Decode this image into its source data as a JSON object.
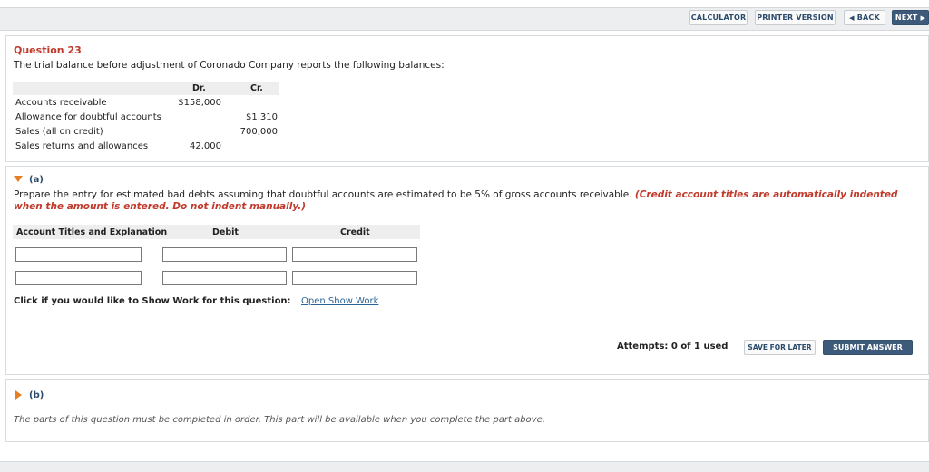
{
  "toolbar": {
    "calculator": "CALCULATOR",
    "printer_version": "PRINTER VERSION",
    "back": "BACK",
    "next": "NEXT"
  },
  "question": {
    "title": "Question 23",
    "text": "The trial balance before adjustment of Coronado Company reports the following balances:"
  },
  "trial_balance": {
    "headers": {
      "dr": "Dr.",
      "cr": "Cr."
    },
    "rows": [
      {
        "label": "Accounts receivable",
        "dr": "$158,000",
        "cr": ""
      },
      {
        "label": "Allowance for doubtful accounts",
        "dr": "",
        "cr": "$1,310"
      },
      {
        "label": "Sales (all on credit)",
        "dr": "",
        "cr": "700,000"
      },
      {
        "label": "Sales returns and allowances",
        "dr": "42,000",
        "cr": ""
      }
    ]
  },
  "part_a": {
    "label": "(a)",
    "instruction": "Prepare the entry for estimated bad debts assuming that doubtful accounts are estimated to be 5% of gross accounts receivable.",
    "instruction_note": "(Credit account titles are automatically indented when the amount is entered. Do not indent manually.)",
    "table_headers": {
      "account": "Account Titles and Explanation",
      "debit": "Debit",
      "credit": "Credit"
    },
    "rows": [
      {
        "account": "",
        "debit": "",
        "credit": ""
      },
      {
        "account": "",
        "debit": "",
        "credit": ""
      }
    ],
    "show_work_prompt": "Click if you would like to Show Work for this question:",
    "show_work_link": "Open Show Work",
    "attempts": "Attempts: 0 of 1 used",
    "save_for_later": "SAVE FOR LATER",
    "submit_answer": "SUBMIT ANSWER"
  },
  "part_b": {
    "label": "(b)",
    "note": "The parts of this question must be completed in order. This part will be available when you complete the part above."
  },
  "colors": {
    "accent_red": "#c0392b",
    "navy": "#3e5a7a",
    "caret_orange": "#e67e22",
    "link_blue": "#2a6496"
  }
}
